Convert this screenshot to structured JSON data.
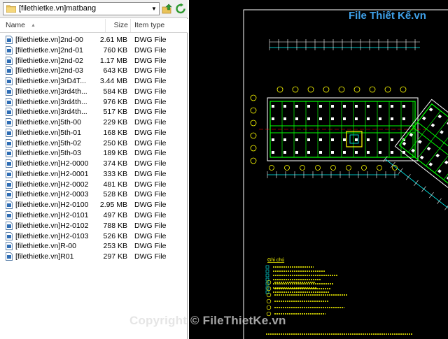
{
  "explorer": {
    "path": "[filethietke.vn]matbang",
    "columns": {
      "name": "Name",
      "size": "Size",
      "type": "Item type"
    },
    "files": [
      {
        "name": "[filethietke.vn]2nd-00",
        "size": "2.61 MB",
        "type": "DWG File"
      },
      {
        "name": "[filethietke.vn]2nd-01",
        "size": "760 KB",
        "type": "DWG File"
      },
      {
        "name": "[filethietke.vn]2nd-02",
        "size": "1.17 MB",
        "type": "DWG File"
      },
      {
        "name": "[filethietke.vn]2nd-03",
        "size": "643 KB",
        "type": "DWG File"
      },
      {
        "name": "[filethietke.vn]3rD4T...",
        "size": "3.44 MB",
        "type": "DWG File"
      },
      {
        "name": "[filethietke.vn]3rd4th...",
        "size": "584 KB",
        "type": "DWG File"
      },
      {
        "name": "[filethietke.vn]3rd4th...",
        "size": "976 KB",
        "type": "DWG File"
      },
      {
        "name": "[filethietke.vn]3rd4th...",
        "size": "517 KB",
        "type": "DWG File"
      },
      {
        "name": "[filethietke.vn]5th-00",
        "size": "229 KB",
        "type": "DWG File"
      },
      {
        "name": "[filethietke.vn]5th-01",
        "size": "168 KB",
        "type": "DWG File"
      },
      {
        "name": "[filethietke.vn]5th-02",
        "size": "250 KB",
        "type": "DWG File"
      },
      {
        "name": "[filethietke.vn]5th-03",
        "size": "189 KB",
        "type": "DWG File"
      },
      {
        "name": "[filethietke.vn]H2-0000",
        "size": "374 KB",
        "type": "DWG File"
      },
      {
        "name": "[filethietke.vn]H2-0001",
        "size": "333 KB",
        "type": "DWG File"
      },
      {
        "name": "[filethietke.vn]H2-0002",
        "size": "481 KB",
        "type": "DWG File"
      },
      {
        "name": "[filethietke.vn]H2-0003",
        "size": "528 KB",
        "type": "DWG File"
      },
      {
        "name": "[filethietke.vn]H2-0100",
        "size": "2.95 MB",
        "type": "DWG File"
      },
      {
        "name": "[filethietke.vn]H2-0101",
        "size": "497 KB",
        "type": "DWG File"
      },
      {
        "name": "[filethietke.vn]H2-0102",
        "size": "788 KB",
        "type": "DWG File"
      },
      {
        "name": "[filethietke.vn]H2-0103",
        "size": "526 KB",
        "type": "DWG File"
      },
      {
        "name": "[filethietke.vn]R-00",
        "size": "253 KB",
        "type": "DWG File"
      },
      {
        "name": "[filethietke.vn]R01",
        "size": "297 KB",
        "type": "DWG File"
      }
    ]
  },
  "preview": {
    "legend_title": "Ghi chú"
  },
  "watermark": {
    "logo": "File Thiết Kế.vn",
    "copyright": "Copyright © FileThietKe.vn"
  },
  "colors": {
    "cad_background": "#000000",
    "cad_white": "#ffffff",
    "cad_green": "#00ff00",
    "cad_cyan": "#00ffff",
    "cad_yellow": "#ffff00",
    "cad_red": "#ff0000",
    "logo_blue": "#3fa0e8"
  }
}
